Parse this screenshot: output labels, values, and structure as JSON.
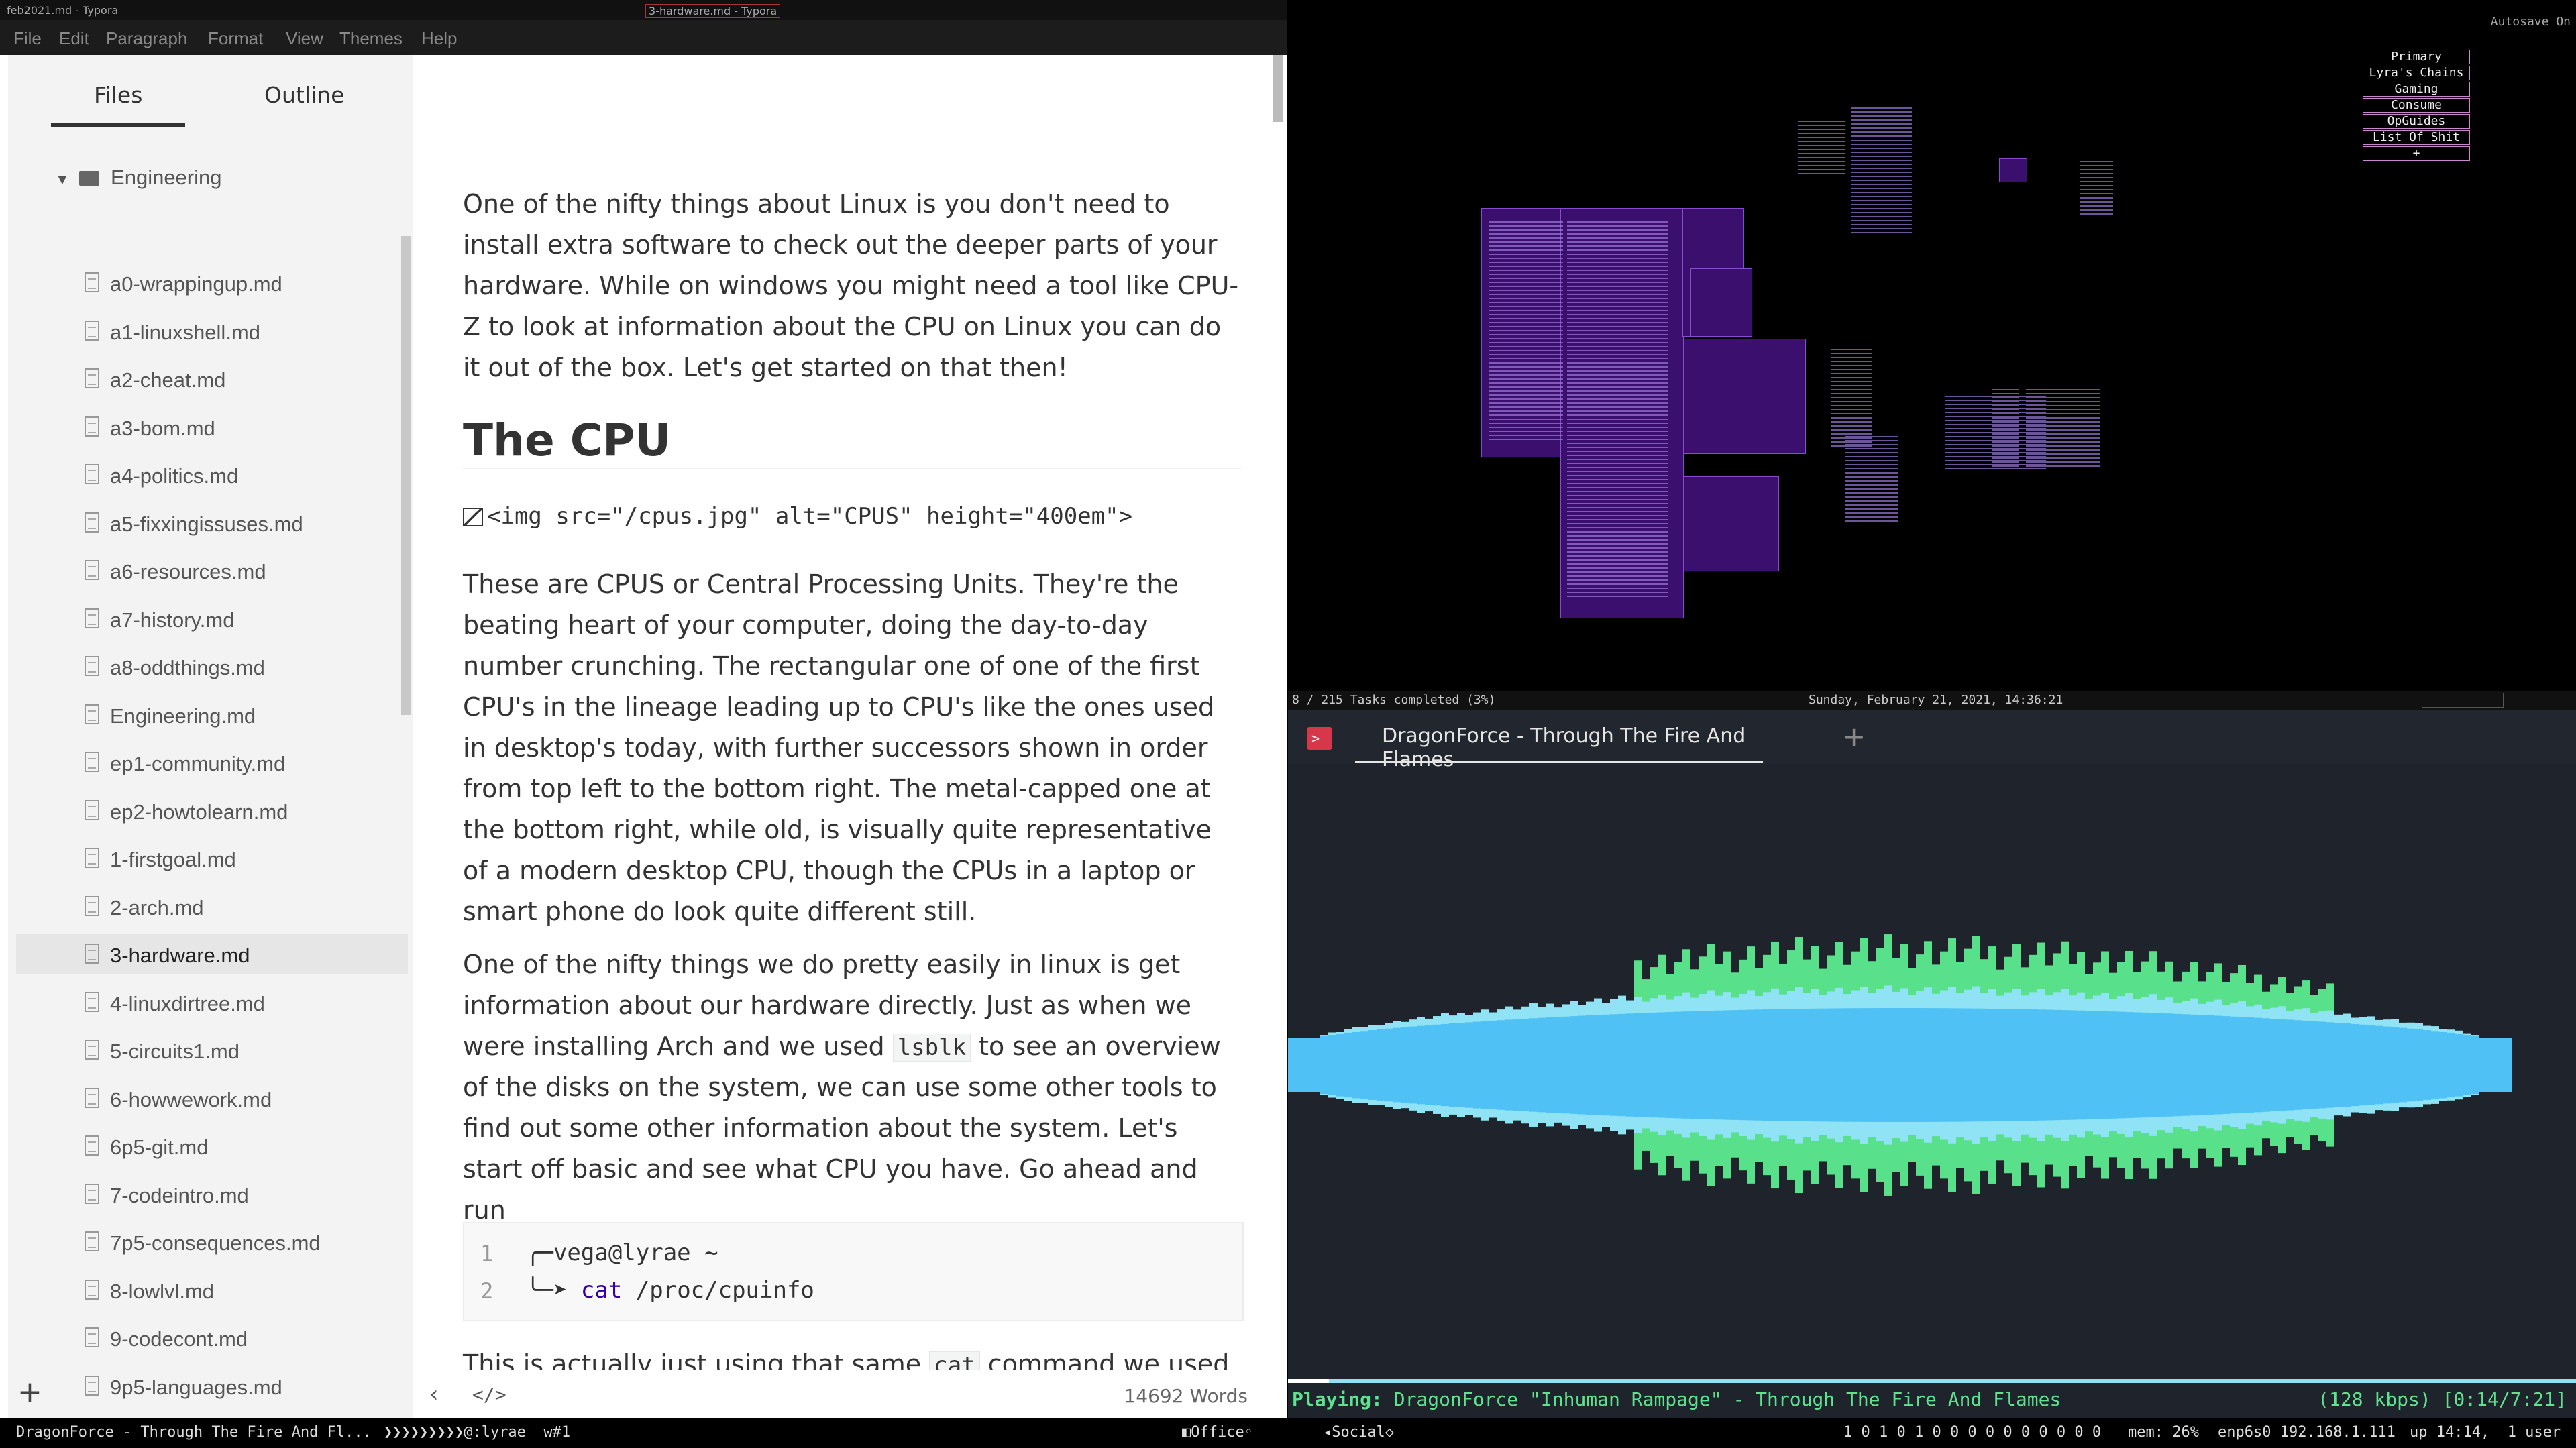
{
  "typora": {
    "title_left": "feb2021.md - Typora",
    "title_center": "3-hardware.md - Typora",
    "menu": [
      "File",
      "Edit",
      "Paragraph",
      "Format",
      "View",
      "Themes",
      "Help"
    ],
    "sidebar": {
      "tab_files": "Files",
      "tab_outline": "Outline",
      "folder": "Engineering",
      "files": [
        "a0-wrappingup.md",
        "a1-linuxshell.md",
        "a2-cheat.md",
        "a3-bom.md",
        "a4-politics.md",
        "a5-fixxingissuses.md",
        "a6-resources.md",
        "a7-history.md",
        "a8-oddthings.md",
        "Engineering.md",
        "ep1-community.md",
        "ep2-howtolearn.md",
        "1-firstgoal.md",
        "2-arch.md",
        "3-hardware.md",
        "4-linuxdirtree.md",
        "5-circuits1.md",
        "6-howwework.md",
        "6p5-git.md",
        "7-codeintro.md",
        "7p5-consequences.md",
        "8-lowlvl.md",
        "9-codecont.md",
        "9p5-languages.md"
      ],
      "active_file": "3-hardware.md",
      "add_label": "+"
    },
    "doc": {
      "p1": "One of the nifty things about Linux is you don't need to install extra software to check out the deeper parts of your hardware. While on windows you might need a tool like CPU-Z to look at information about the CPU on Linux you can do it out of the box. Let's get started on that then!",
      "h2": "The CPU",
      "img_tag": "<img src=\"/cpus.jpg\" alt=\"CPUS\" height=\"400em\">",
      "p2": "These are CPUS or Central Processing Units. They're the beating heart of your computer, doing the day-to-day number crunching. The rectangular one of one of the first CPU's in the lineage leading up to CPU's like the ones used in desktop's today, with further successors shown in order from top left to the bottom right. The metal-capped one at the bottom right, while old, is visually quite representative of a modern desktop CPU, though the CPUs in a laptop or smart phone do look quite different still.",
      "p3_a": "One of the nifty things we do pretty easily in linux is get information about our hardware directly. Just as when we were installing Arch and we used ",
      "p3_code": "lsblk",
      "p3_b": " to see an overview of the disks on the system, we can use some other tools to find out some other information about the system. Let's start off basic and see what CPU you have. Go ahead and run",
      "code": {
        "ln1": "1",
        "ln2": "2",
        "line1": "╭─vega@lyrae ~",
        "line2_prefix": "╰─➤  ",
        "line2_cmd": "cat",
        "line2_arg": " /proc/cpuinfo"
      },
      "p4_a": "This is actually just using that same ",
      "p4_code": "cat",
      "p4_b": " command we used"
    },
    "footer": {
      "back": "‹",
      "source": "</>",
      "words": "14692 Words"
    }
  },
  "overview": {
    "autosave": "Autosave On",
    "workspaces": [
      "Primary",
      "Lyra's Chains",
      "Gaming",
      "Consume",
      "OpGuides",
      "List Of Shit",
      "+"
    ],
    "status_left": "8 / 215 Tasks completed (3%)",
    "status_center": "Sunday, February 21, 2021, 14:36:21"
  },
  "terminal": {
    "icon_label": ">_",
    "tab_title": "DragonForce - Through The Fire And Flames",
    "new_tab": "+",
    "playing_label": "Playing:",
    "track": "DragonForce \"Inhuman Rampage\" - Through The Fire And Flames",
    "status": "(128 kbps) [0:14/7:21]",
    "progress": 0.032,
    "colors": {
      "outer": "#58e08a",
      "mid": "#8fe3f5",
      "core": "#4fc1f5",
      "peak": "#f5f08a"
    }
  },
  "panel": {
    "window": "DragonForce - Through The Fire And Fl...",
    "prompt": "❯❯❯❯❯❯❯❯❯@:lyrae  w#1",
    "office": "◧Office◦",
    "social": "◂Social◇",
    "tags": "1 0 1 0 1 0 0 0 0 0 0 0 0 0 0",
    "mem": "mem: 26%",
    "net": "enp6s0 192.168.1.111",
    "uptime": "up 14:14,  1 user"
  }
}
